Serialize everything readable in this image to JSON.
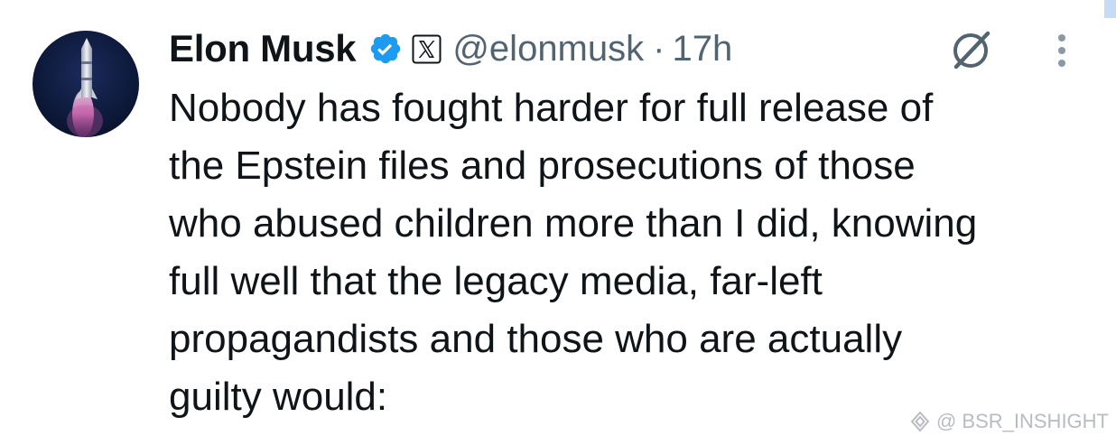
{
  "tweet": {
    "author_name": "Elon Musk",
    "handle": "@elonmusk",
    "separator": "·",
    "timestamp": "17h",
    "text": "Nobody has fought harder for full release of\nthe Epstein files and prosecutions of those\nwho abused children more than I did, knowing\nfull well that the legacy media, far-left\npropagandists and those who are actually\nguilty would:"
  },
  "icons": {
    "verified": "verified-badge-icon",
    "affiliate": "x-logo-icon",
    "grok": "grok-icon",
    "more": "more-vertical-icon"
  },
  "watermark": {
    "text": "@ BSR_INSHIGHT"
  },
  "colors": {
    "text_primary": "#0f1419",
    "text_secondary": "#536471",
    "verified_blue": "#1d9bf0",
    "background": "#ffffff"
  }
}
